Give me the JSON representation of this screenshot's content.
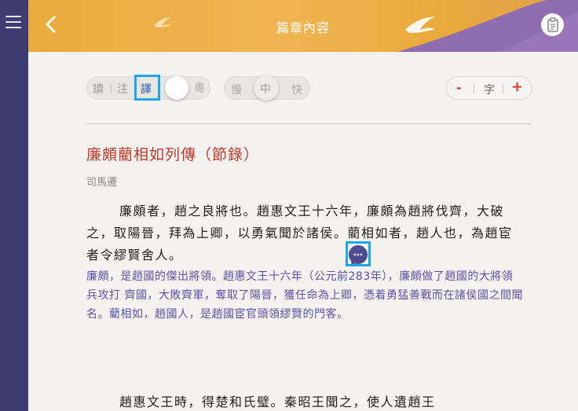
{
  "header": {
    "title": "篇章內容",
    "back_icon": "chevron-left-icon",
    "notes_icon": "notes-icon",
    "menu_icon": "hamburger-menu-icon",
    "colors": {
      "header": "#eaab3c",
      "purple_band": "#8e6db1",
      "rail": "#3d3d73"
    }
  },
  "toolbar": {
    "modes": [
      "讀",
      "注",
      "譯"
    ],
    "selected_mode": "譯",
    "canto_label": "粵",
    "speed": {
      "slow": "慢",
      "medium": "中",
      "fast": "快",
      "selected": "中"
    },
    "font": {
      "minus": "-",
      "label": "字",
      "plus": "+"
    }
  },
  "article": {
    "title": "廉頗藺相如列傳（節錄）",
    "author": "司馬遷",
    "paragraph1": "廉頗者，趙之良將也。趙惠文王十六年，廉頗為趙將伐齊，大破之，取陽晉，拜為上卿，以勇氣聞於諸侯。藺相如者，趙人也，為趙宦者令繆賢舍人。",
    "translation1": "廉頗，是趙國的傑出將領。趙惠文王十六年（公元前283年），廉頗做了趙國的大將領兵攻打 齊國，大敗齊軍，奪取了陽晉，獲任命為上卿，憑着勇猛善戰而在諸侯國之間聞名。藺相如，趙國人，是趙國宦官頭領繆賢的門客。",
    "paragraph2": "趙惠文王時，得楚和氏璧。秦昭王聞之，使人遺趙王",
    "comment_icon": "speech-bubble-icon",
    "colors": {
      "title": "#c0392b",
      "translation": "#5b52a8",
      "highlight": "#1ea7e8"
    }
  }
}
